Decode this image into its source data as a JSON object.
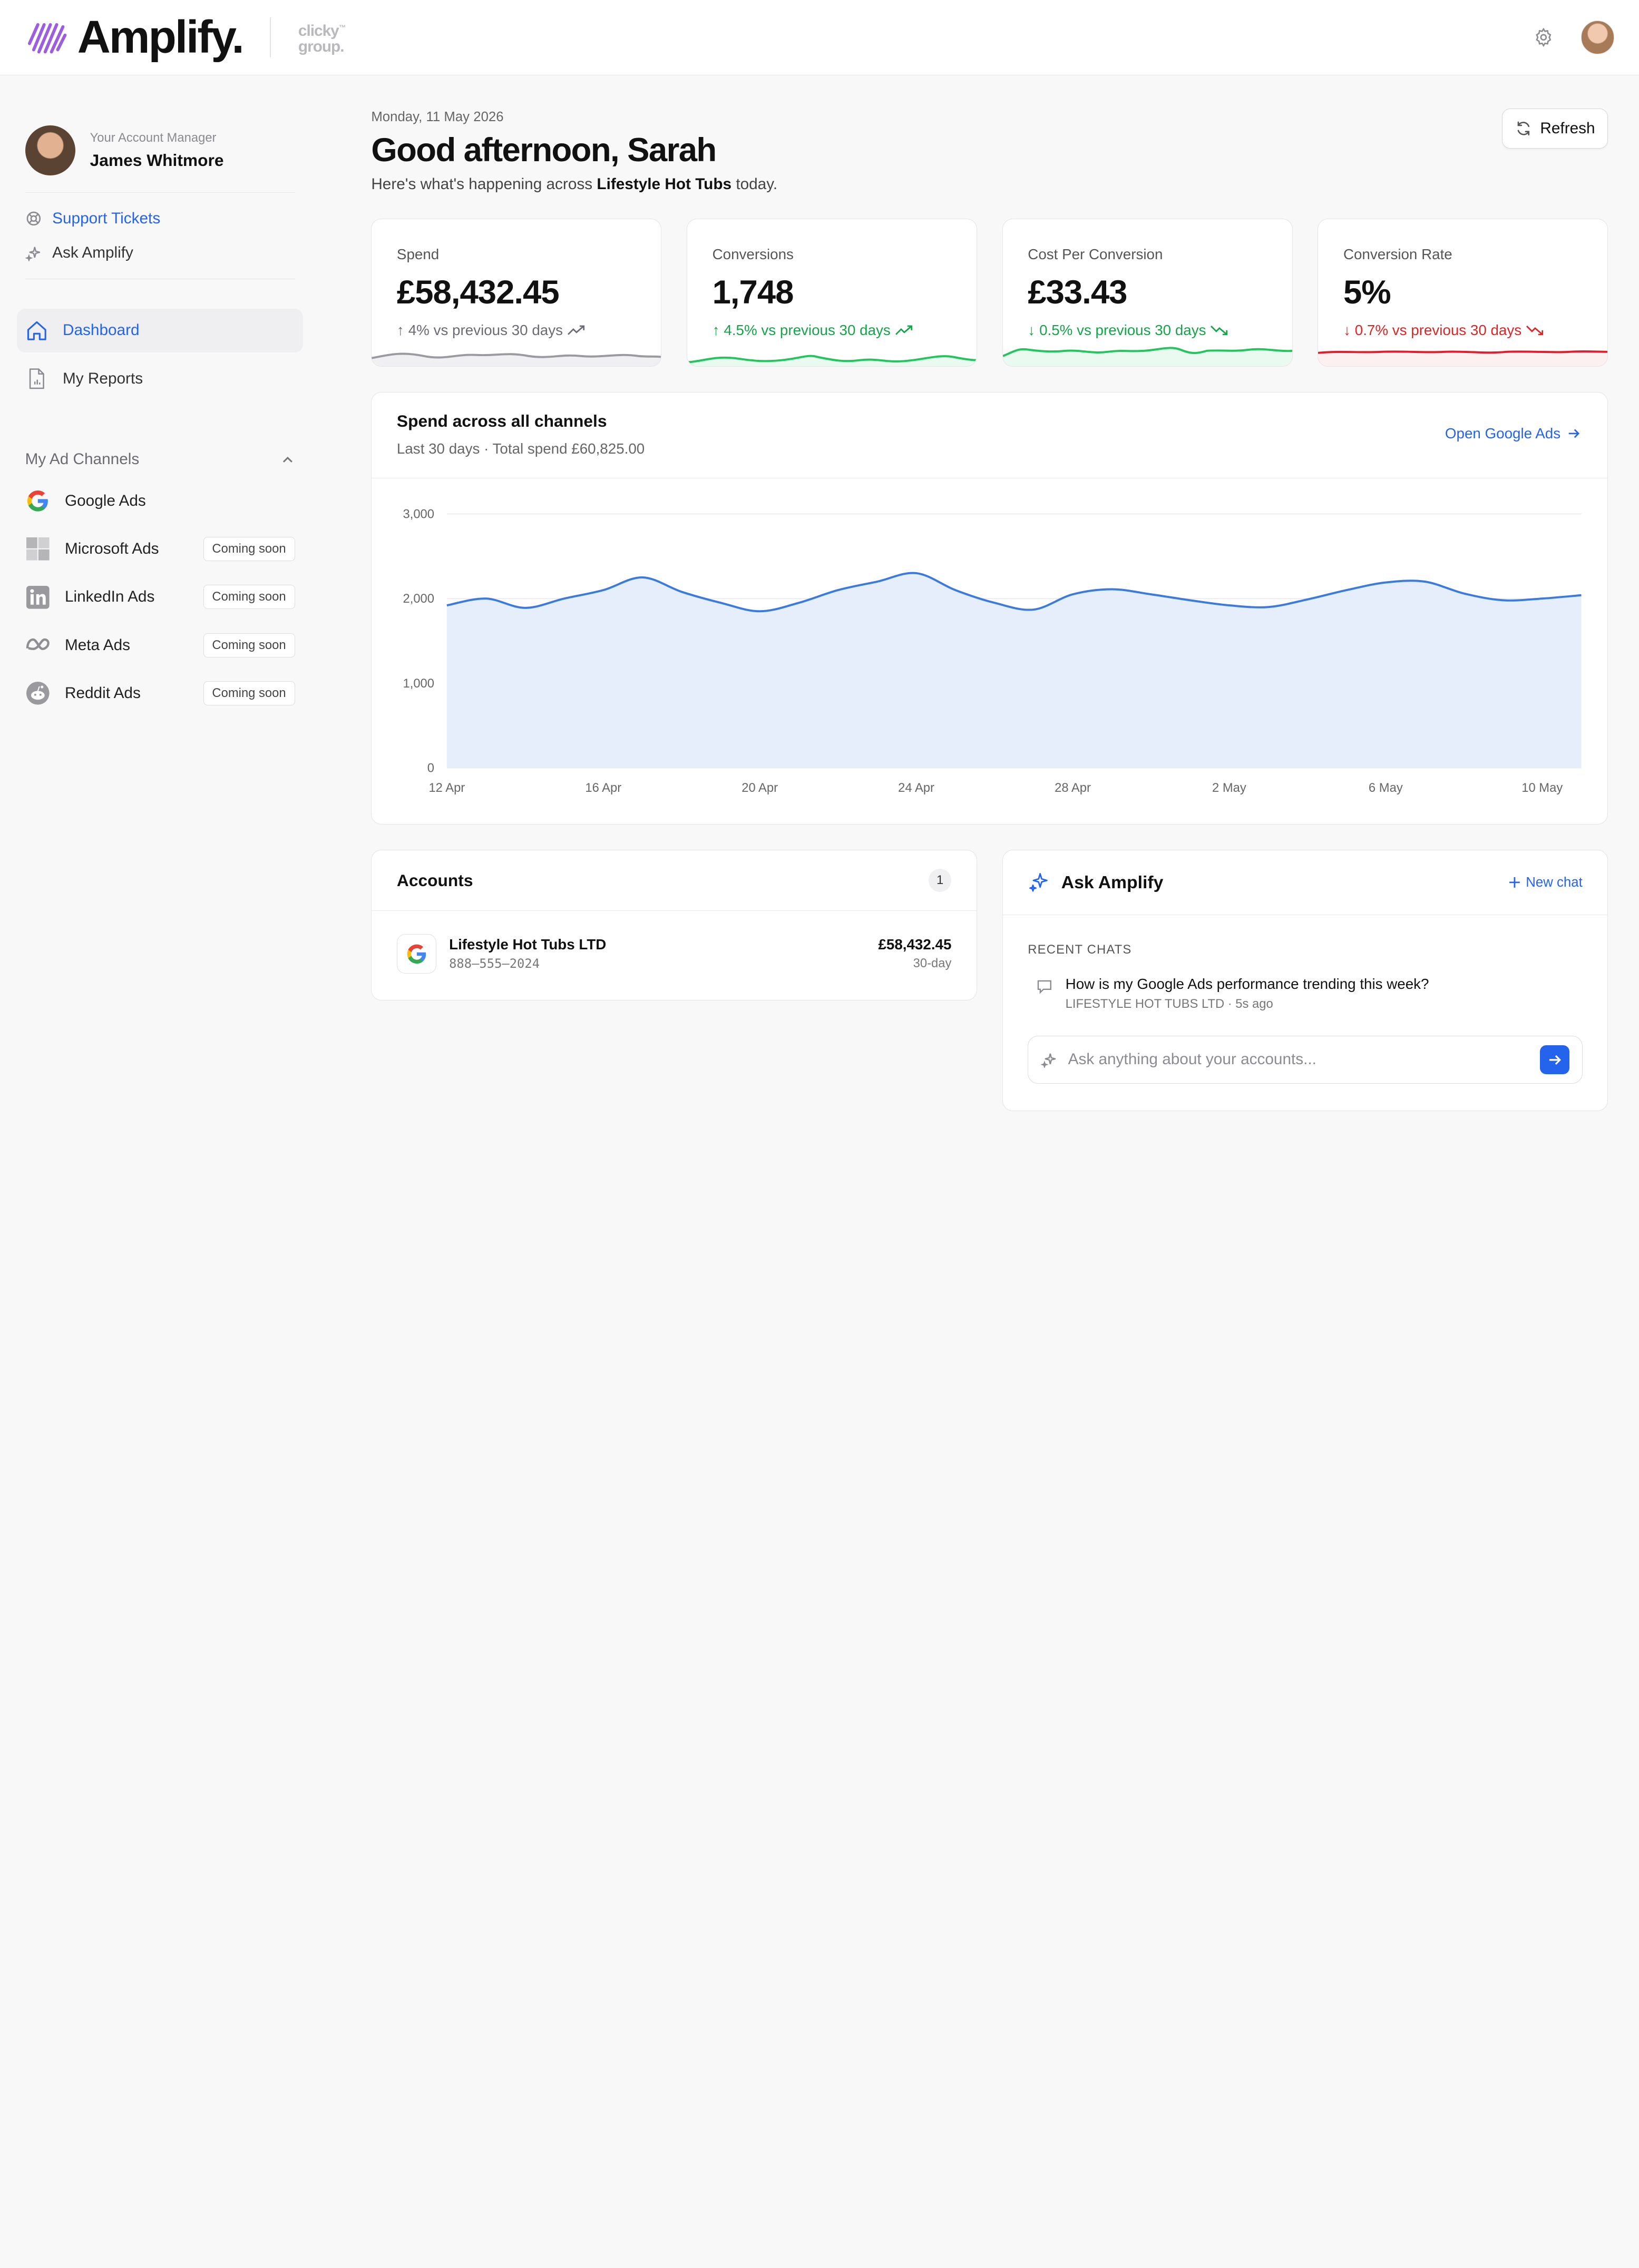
{
  "brand": {
    "name": "Amplify.",
    "partner_line1": "clicky",
    "partner_line2": "group."
  },
  "account_manager": {
    "label": "Your Account Manager",
    "name": "James Whitmore"
  },
  "side_links": [
    {
      "label": "Support Tickets",
      "icon": "lifebuoy-icon"
    },
    {
      "label": "Ask Amplify",
      "icon": "sparkle-icon"
    }
  ],
  "nav": [
    {
      "label": "Dashboard",
      "icon": "home-icon",
      "active": true
    },
    {
      "label": "My Reports",
      "icon": "report-file-icon",
      "active": false
    }
  ],
  "channels_section": {
    "title": "My Ad Channels"
  },
  "channels": [
    {
      "label": "Google Ads",
      "badge": ""
    },
    {
      "label": "Microsoft Ads",
      "badge": "Coming soon"
    },
    {
      "label": "LinkedIn Ads",
      "badge": "Coming soon"
    },
    {
      "label": "Meta Ads",
      "badge": "Coming soon"
    },
    {
      "label": "Reddit Ads",
      "badge": "Coming soon"
    }
  ],
  "header": {
    "date": "Monday, 11 May 2026",
    "greeting": "Good afternoon, Sarah",
    "sub_prefix": "Here's what's happening across",
    "sub_client": "Lifestyle Hot Tubs",
    "sub_suffix": "today.",
    "refresh_label": "Refresh"
  },
  "kpis": [
    {
      "label": "Spend",
      "value": "£58,432.45",
      "delta": "4% vs previous 30 days",
      "direction": "up",
      "color": "#6b6b72"
    },
    {
      "label": "Conversions",
      "value": "1,748",
      "delta": "4.5% vs previous 30 days",
      "direction": "up",
      "color": "#16a34a"
    },
    {
      "label": "Cost Per Conversion",
      "value": "£33.43",
      "delta": "0.5% vs previous 30 days",
      "direction": "down",
      "color": "#16a34a"
    },
    {
      "label": "Conversion Rate",
      "value": "5%",
      "delta": "0.7% vs previous 30 days",
      "direction": "down",
      "color": "#dc2626"
    }
  ],
  "spend_card": {
    "title": "Spend across all channels",
    "subtitle": "Last 30 days · Total spend £60,825.00",
    "link": "Open Google Ads"
  },
  "chart_data": {
    "type": "area",
    "x_ticks": [
      "12 Apr",
      "16 Apr",
      "20 Apr",
      "24 Apr",
      "28 Apr",
      "2 May",
      "6 May",
      "10 May"
    ],
    "y_ticks": [
      "0",
      "1,000",
      "2,000",
      "3,000"
    ],
    "ylim": [
      0,
      3000
    ],
    "x_dates": [
      "12 Apr",
      "13 Apr",
      "14 Apr",
      "15 Apr",
      "16 Apr",
      "17 Apr",
      "18 Apr",
      "19 Apr",
      "20 Apr",
      "21 Apr",
      "22 Apr",
      "23 Apr",
      "24 Apr",
      "25 Apr",
      "26 Apr",
      "27 Apr",
      "28 Apr",
      "29 Apr",
      "30 Apr",
      "1 May",
      "2 May",
      "3 May",
      "4 May",
      "5 May",
      "6 May",
      "7 May",
      "8 May",
      "9 May",
      "10 May",
      "11 May"
    ],
    "values": [
      1920,
      2000,
      1890,
      2000,
      2100,
      2250,
      2080,
      1950,
      1850,
      1950,
      2100,
      2200,
      2300,
      2100,
      1950,
      1870,
      2050,
      2110,
      2050,
      1980,
      1920,
      1900,
      1990,
      2100,
      2190,
      2200,
      2060,
      1980,
      2000,
      2040
    ],
    "line_color": "#3b7be0",
    "fill_color": "#e6eefb",
    "grid": true
  },
  "accounts": {
    "title": "Accounts",
    "count": "1",
    "rows": [
      {
        "name": "Lifestyle Hot Tubs LTD",
        "phone": "888–555–2024",
        "amount": "£58,432.45",
        "period": "30-day"
      }
    ]
  },
  "ask": {
    "title": "Ask Amplify",
    "new_chat": "New chat",
    "recent_label": "RECENT CHATS",
    "chats": [
      {
        "question": "How is my Google Ads performance trending this week?",
        "meta": "LIFESTYLE HOT TUBS LTD · 5s ago"
      }
    ],
    "placeholder": "Ask anything about your accounts..."
  }
}
